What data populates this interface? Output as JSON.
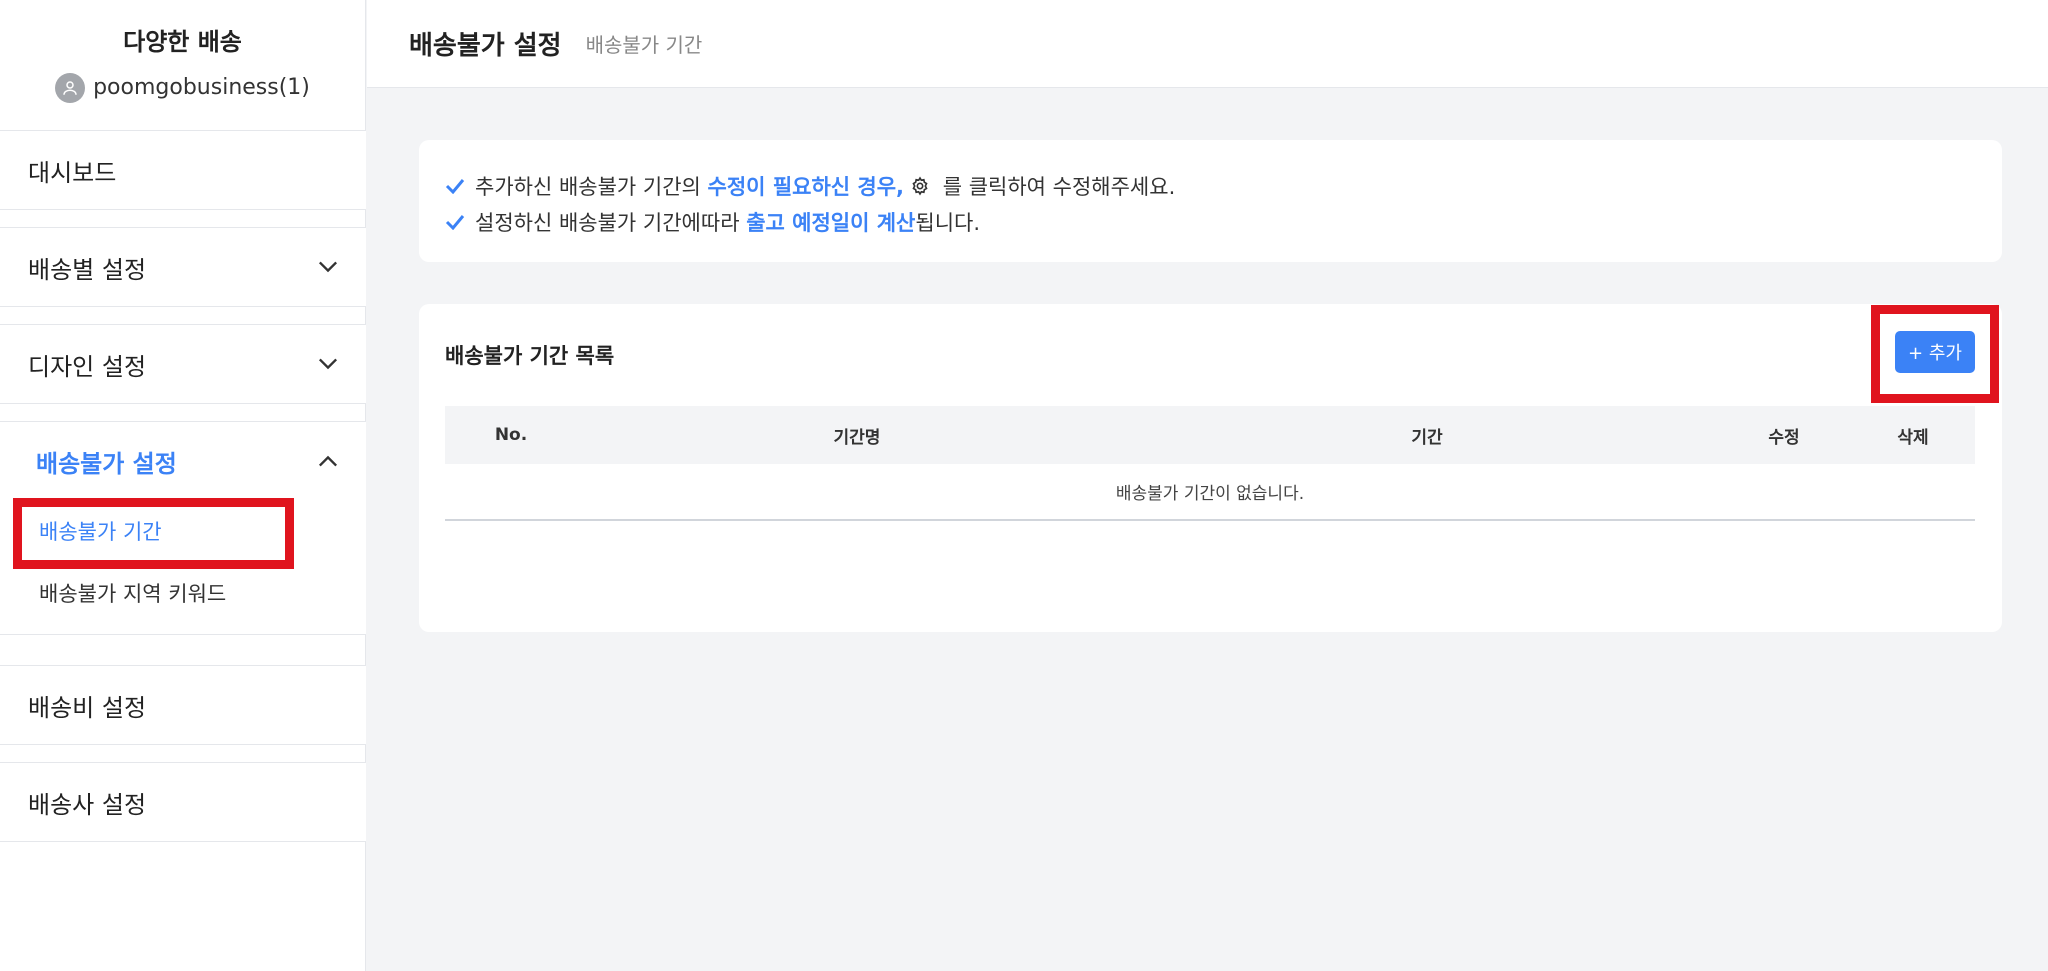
{
  "sidebar": {
    "brand_title": "다양한 배송",
    "username": "poomgobusiness(1)",
    "menu": {
      "dashboard": "대시보드",
      "shipping_settings": "배송별 설정",
      "design_settings": "디자인 설정",
      "undeliverable_settings": "배송불가 설정",
      "undeliverable_period": "배송불가 기간",
      "undeliverable_keyword": "배송불가 지역 키워드",
      "shipping_fee_settings": "배송비 설정",
      "carrier_settings": "배송사 설정"
    }
  },
  "header": {
    "title": "배송불가 설정",
    "subtitle": "배송불가 기간"
  },
  "notice": {
    "line1_a": "추가하신 배송불가 기간의 ",
    "line1_em": "수정이 필요하신 경우,",
    "line1_b": " 를 클릭하여 수정해주세요.",
    "line2_a": "설정하신 배송불가 기간에따라 ",
    "line2_em": "출고 예정일이 계산",
    "line2_b": "됩니다."
  },
  "list": {
    "title": "배송불가 기간 목록",
    "add_button": "+ 추가",
    "columns": [
      "No.",
      "기간명",
      "기간",
      "수정",
      "삭제"
    ],
    "empty_message": "배송불가 기간이 없습니다."
  },
  "colors": {
    "accent": "#3b82f6",
    "highlight": "#e0141e",
    "background": "#f3f4f6"
  },
  "icons": [
    "user-icon",
    "chevron-down-icon",
    "chevron-up-icon",
    "check-icon",
    "gear-icon"
  ]
}
